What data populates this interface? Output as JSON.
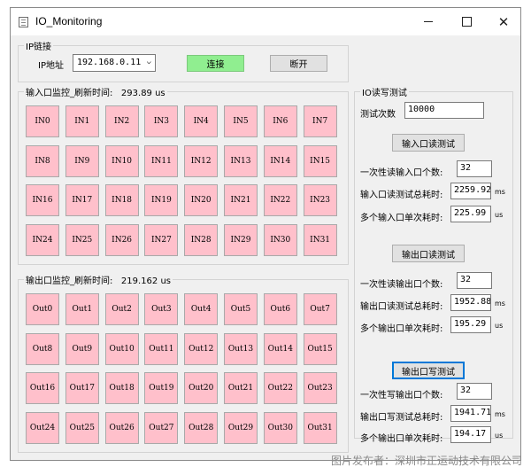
{
  "window": {
    "title": "IO_Monitoring",
    "minimize_glyph": "",
    "close_glyph": "✕"
  },
  "ip_group": {
    "title": "IP链接",
    "ip_label": "IP地址",
    "ip_value": "192.168.0.11",
    "connect_label": "连接",
    "disconnect_label": "断开"
  },
  "input_group": {
    "title": "输入口监控_刷新时间:",
    "refresh_time": "293.89 us",
    "cells": [
      "IN0",
      "IN1",
      "IN2",
      "IN3",
      "IN4",
      "IN5",
      "IN6",
      "IN7",
      "IN8",
      "IN9",
      "IN10",
      "IN11",
      "IN12",
      "IN13",
      "IN14",
      "IN15",
      "IN16",
      "IN17",
      "IN18",
      "IN19",
      "IN20",
      "IN21",
      "IN22",
      "IN23",
      "IN24",
      "IN25",
      "IN26",
      "IN27",
      "IN28",
      "IN29",
      "IN30",
      "IN31"
    ]
  },
  "output_group": {
    "title": "输出口监控_刷新时间:",
    "refresh_time": "219.162 us",
    "cells": [
      "Out0",
      "Out1",
      "Out2",
      "Out3",
      "Out4",
      "Out5",
      "Out6",
      "Out7",
      "Out8",
      "Out9",
      "Out10",
      "Out11",
      "Out12",
      "Out13",
      "Out14",
      "Out15",
      "Out16",
      "Out17",
      "Out18",
      "Out19",
      "Out20",
      "Out21",
      "Out22",
      "Out23",
      "Out24",
      "Out25",
      "Out26",
      "Out27",
      "Out28",
      "Out29",
      "Out30",
      "Out31"
    ]
  },
  "rw_test": {
    "title": "IO读写测试",
    "test_count_label": "测试次数",
    "test_count": "10000",
    "input_read": {
      "button": "输入口读测试",
      "count_label": "一次性读输入口个数:",
      "count": "32",
      "total_label": "输入口读测试总耗时:",
      "total": "2259.92",
      "total_unit": "ms",
      "single_label": "多个输入口单次耗时:",
      "single": "225.99",
      "single_unit": "us"
    },
    "output_read": {
      "button": "输出口读测试",
      "count_label": "一次性读输出口个数:",
      "count": "32",
      "total_label": "输出口读测试总耗时:",
      "total": "1952.88",
      "total_unit": "ms",
      "single_label": "多个输出口单次耗时:",
      "single": "195.29",
      "single_unit": "us"
    },
    "output_write": {
      "button": "输出口写测试",
      "count_label": "一次性写输出口个数:",
      "count": "32",
      "total_label": "输出口写测试总耗时:",
      "total": "1941.71",
      "total_unit": "ms",
      "single_label": "多个输出口单次耗时:",
      "single": "194.17",
      "single_unit": "us"
    }
  },
  "watermark": "图片发布者：深圳市正运动技术有限公司"
}
